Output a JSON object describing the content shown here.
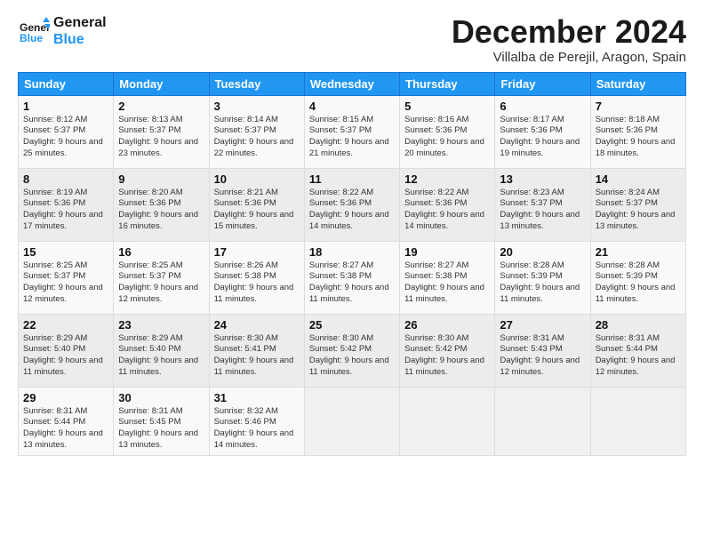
{
  "logo": {
    "line1": "General",
    "line2": "Blue"
  },
  "title": "December 2024",
  "location": "Villalba de Perejil, Aragon, Spain",
  "days_header": [
    "Sunday",
    "Monday",
    "Tuesday",
    "Wednesday",
    "Thursday",
    "Friday",
    "Saturday"
  ],
  "weeks": [
    [
      {
        "day": "1",
        "sunrise": "8:12 AM",
        "sunset": "5:37 PM",
        "daylight": "9 hours and 25 minutes."
      },
      {
        "day": "2",
        "sunrise": "8:13 AM",
        "sunset": "5:37 PM",
        "daylight": "9 hours and 23 minutes."
      },
      {
        "day": "3",
        "sunrise": "8:14 AM",
        "sunset": "5:37 PM",
        "daylight": "9 hours and 22 minutes."
      },
      {
        "day": "4",
        "sunrise": "8:15 AM",
        "sunset": "5:37 PM",
        "daylight": "9 hours and 21 minutes."
      },
      {
        "day": "5",
        "sunrise": "8:16 AM",
        "sunset": "5:36 PM",
        "daylight": "9 hours and 20 minutes."
      },
      {
        "day": "6",
        "sunrise": "8:17 AM",
        "sunset": "5:36 PM",
        "daylight": "9 hours and 19 minutes."
      },
      {
        "day": "7",
        "sunrise": "8:18 AM",
        "sunset": "5:36 PM",
        "daylight": "9 hours and 18 minutes."
      }
    ],
    [
      {
        "day": "8",
        "sunrise": "8:19 AM",
        "sunset": "5:36 PM",
        "daylight": "9 hours and 17 minutes."
      },
      {
        "day": "9",
        "sunrise": "8:20 AM",
        "sunset": "5:36 PM",
        "daylight": "9 hours and 16 minutes."
      },
      {
        "day": "10",
        "sunrise": "8:21 AM",
        "sunset": "5:36 PM",
        "daylight": "9 hours and 15 minutes."
      },
      {
        "day": "11",
        "sunrise": "8:22 AM",
        "sunset": "5:36 PM",
        "daylight": "9 hours and 14 minutes."
      },
      {
        "day": "12",
        "sunrise": "8:22 AM",
        "sunset": "5:36 PM",
        "daylight": "9 hours and 14 minutes."
      },
      {
        "day": "13",
        "sunrise": "8:23 AM",
        "sunset": "5:37 PM",
        "daylight": "9 hours and 13 minutes."
      },
      {
        "day": "14",
        "sunrise": "8:24 AM",
        "sunset": "5:37 PM",
        "daylight": "9 hours and 13 minutes."
      }
    ],
    [
      {
        "day": "15",
        "sunrise": "8:25 AM",
        "sunset": "5:37 PM",
        "daylight": "9 hours and 12 minutes."
      },
      {
        "day": "16",
        "sunrise": "8:25 AM",
        "sunset": "5:37 PM",
        "daylight": "9 hours and 12 minutes."
      },
      {
        "day": "17",
        "sunrise": "8:26 AM",
        "sunset": "5:38 PM",
        "daylight": "9 hours and 11 minutes."
      },
      {
        "day": "18",
        "sunrise": "8:27 AM",
        "sunset": "5:38 PM",
        "daylight": "9 hours and 11 minutes."
      },
      {
        "day": "19",
        "sunrise": "8:27 AM",
        "sunset": "5:38 PM",
        "daylight": "9 hours and 11 minutes."
      },
      {
        "day": "20",
        "sunrise": "8:28 AM",
        "sunset": "5:39 PM",
        "daylight": "9 hours and 11 minutes."
      },
      {
        "day": "21",
        "sunrise": "8:28 AM",
        "sunset": "5:39 PM",
        "daylight": "9 hours and 11 minutes."
      }
    ],
    [
      {
        "day": "22",
        "sunrise": "8:29 AM",
        "sunset": "5:40 PM",
        "daylight": "9 hours and 11 minutes."
      },
      {
        "day": "23",
        "sunrise": "8:29 AM",
        "sunset": "5:40 PM",
        "daylight": "9 hours and 11 minutes."
      },
      {
        "day": "24",
        "sunrise": "8:30 AM",
        "sunset": "5:41 PM",
        "daylight": "9 hours and 11 minutes."
      },
      {
        "day": "25",
        "sunrise": "8:30 AM",
        "sunset": "5:42 PM",
        "daylight": "9 hours and 11 minutes."
      },
      {
        "day": "26",
        "sunrise": "8:30 AM",
        "sunset": "5:42 PM",
        "daylight": "9 hours and 11 minutes."
      },
      {
        "day": "27",
        "sunrise": "8:31 AM",
        "sunset": "5:43 PM",
        "daylight": "9 hours and 12 minutes."
      },
      {
        "day": "28",
        "sunrise": "8:31 AM",
        "sunset": "5:44 PM",
        "daylight": "9 hours and 12 minutes."
      }
    ],
    [
      {
        "day": "29",
        "sunrise": "8:31 AM",
        "sunset": "5:44 PM",
        "daylight": "9 hours and 13 minutes."
      },
      {
        "day": "30",
        "sunrise": "8:31 AM",
        "sunset": "5:45 PM",
        "daylight": "9 hours and 13 minutes."
      },
      {
        "day": "31",
        "sunrise": "8:32 AM",
        "sunset": "5:46 PM",
        "daylight": "9 hours and 14 minutes."
      },
      null,
      null,
      null,
      null
    ]
  ]
}
